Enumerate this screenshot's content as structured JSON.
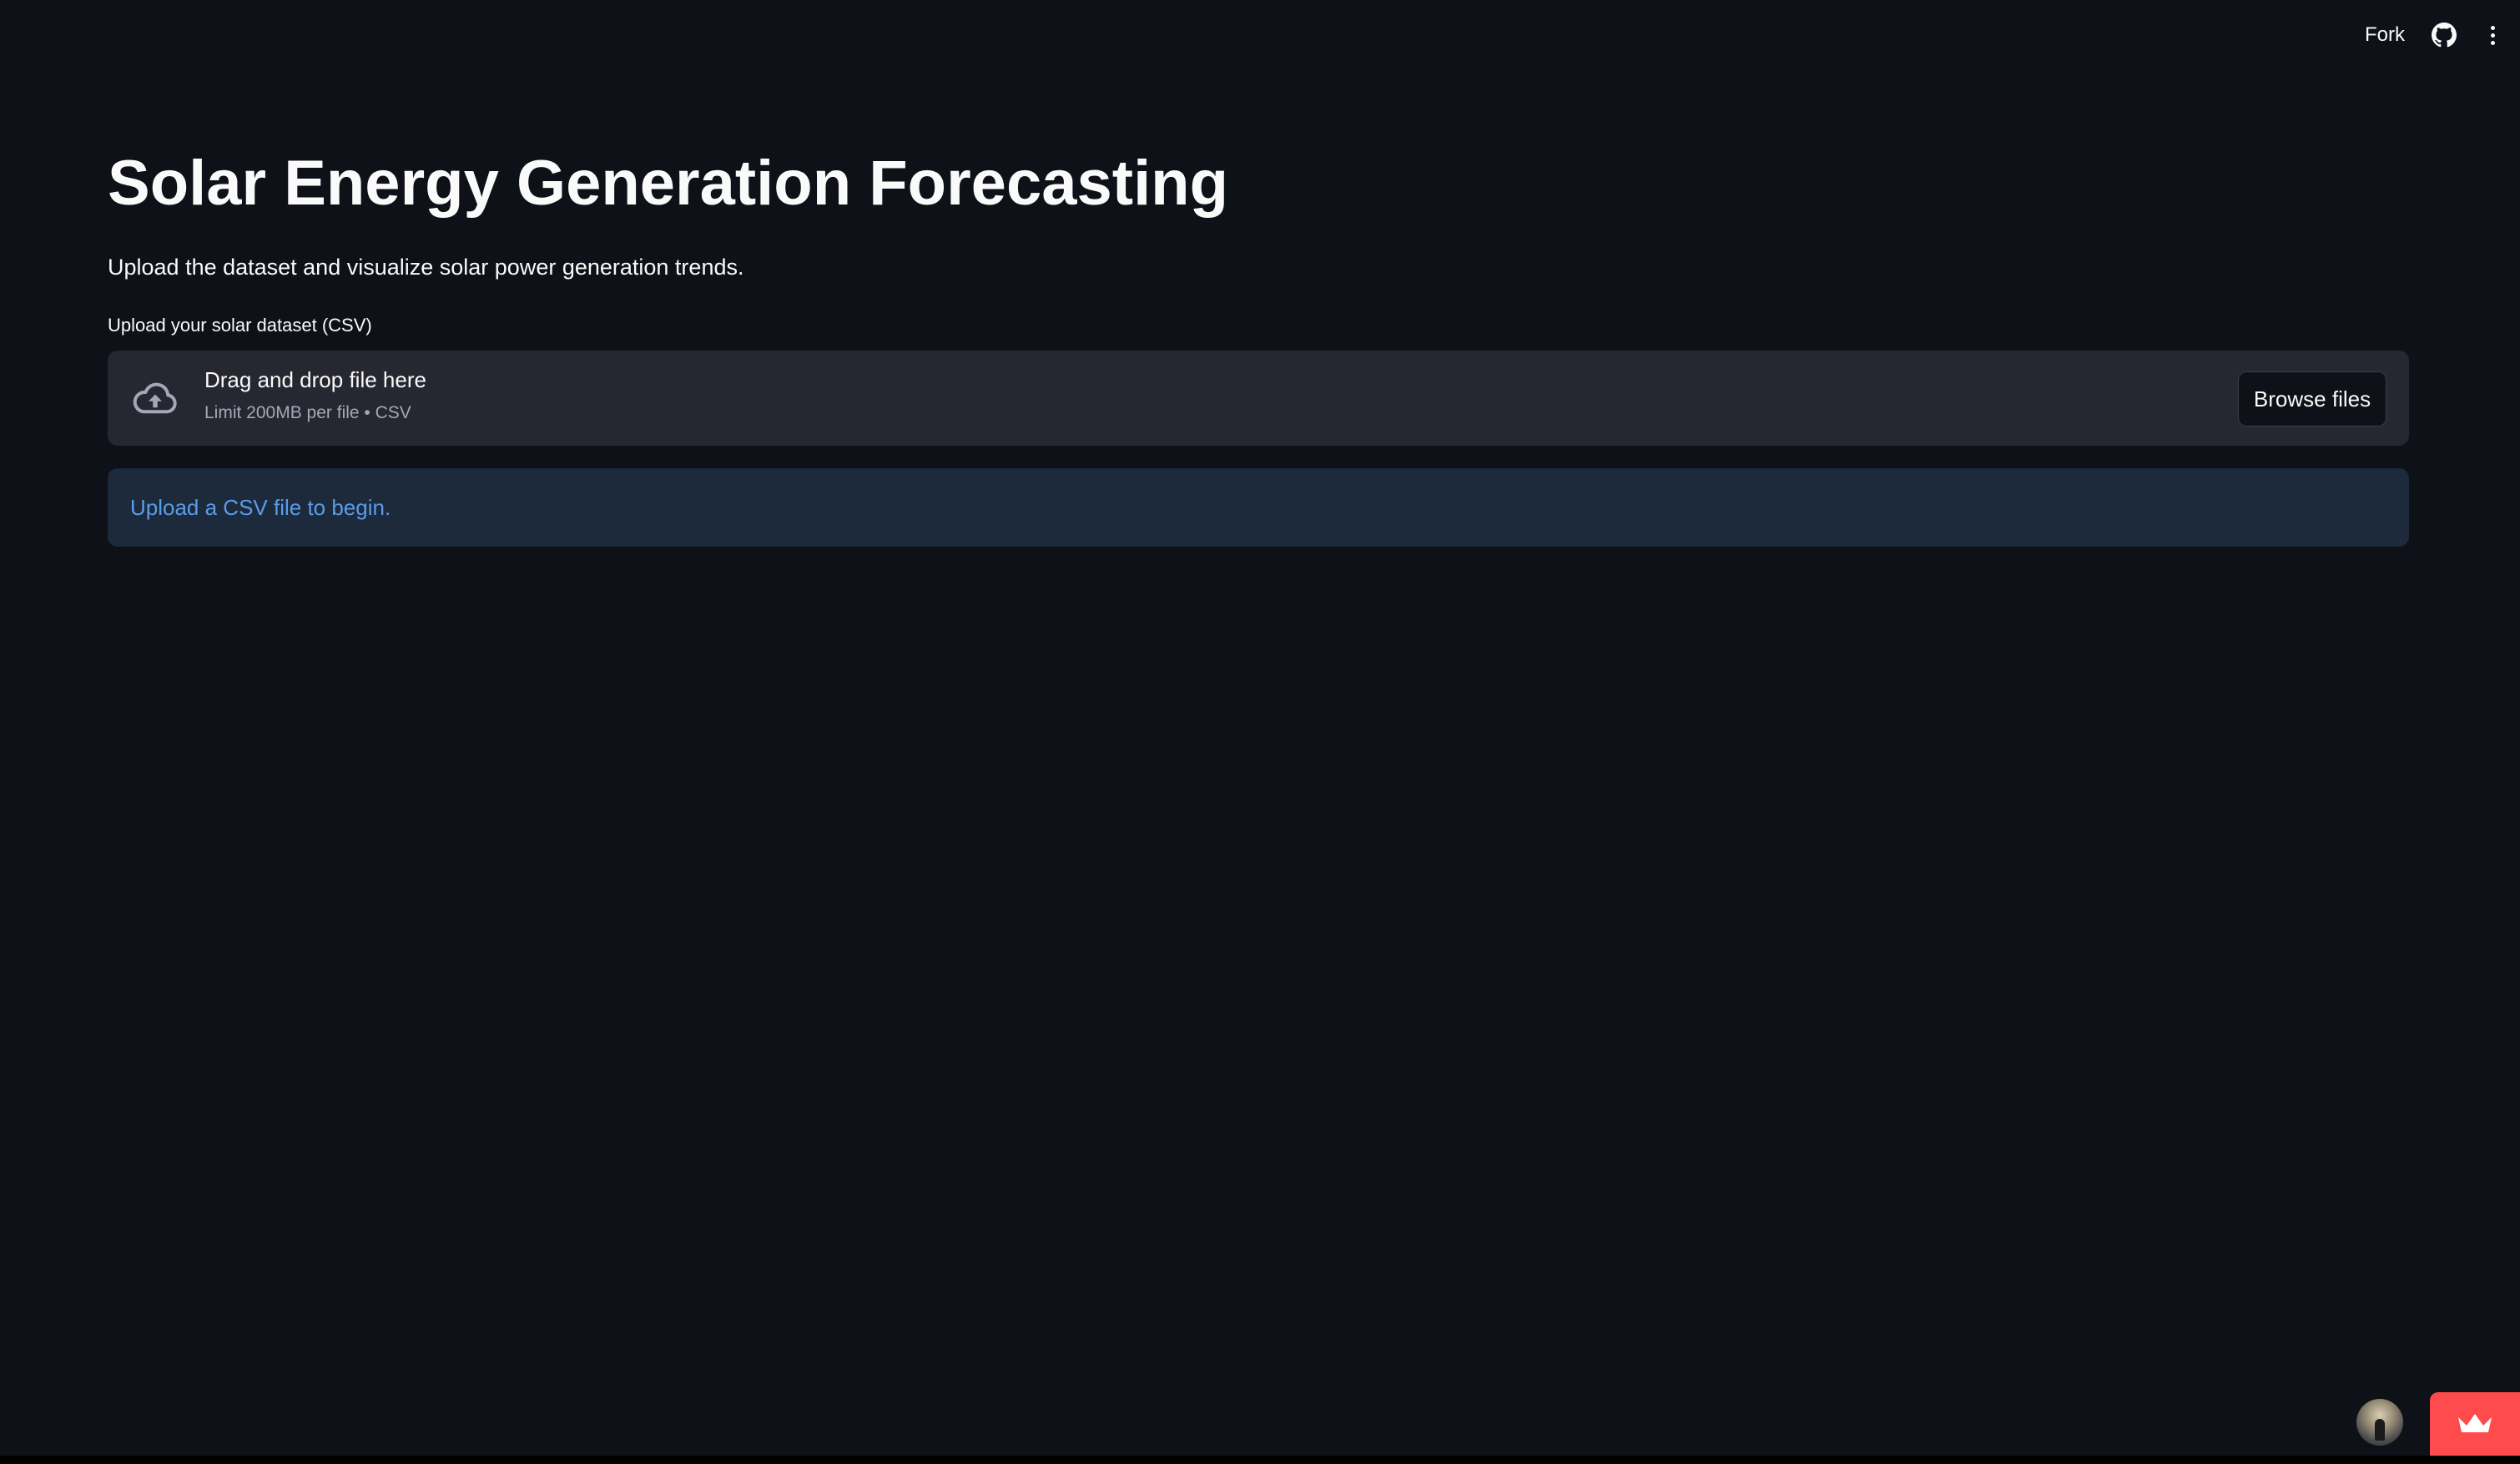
{
  "header": {
    "fork_label": "Fork",
    "github_icon": "github-icon",
    "menu_icon": "more-vertical-icon"
  },
  "main": {
    "title": "Solar Energy Generation Forecasting",
    "subtitle": "Upload the dataset and visualize solar power generation trends.",
    "uploader": {
      "label": "Upload your solar dataset (CSV)",
      "icon": "cloud-upload-icon",
      "instructions": "Drag and drop file here",
      "limit_text": "Limit 200MB per file • CSV",
      "browse_label": "Browse files"
    },
    "info_alert": {
      "text": "Upload a CSV file to begin."
    }
  },
  "footer": {
    "avatar_icon": "viewer-avatar",
    "badge_icon": "crown-icon"
  },
  "colors": {
    "background": "#0e1117",
    "dropzone_bg": "#262730",
    "info_bg": "#1c2a3c",
    "info_text": "#5a9ce8",
    "badge_bg": "#ff4b4b"
  }
}
